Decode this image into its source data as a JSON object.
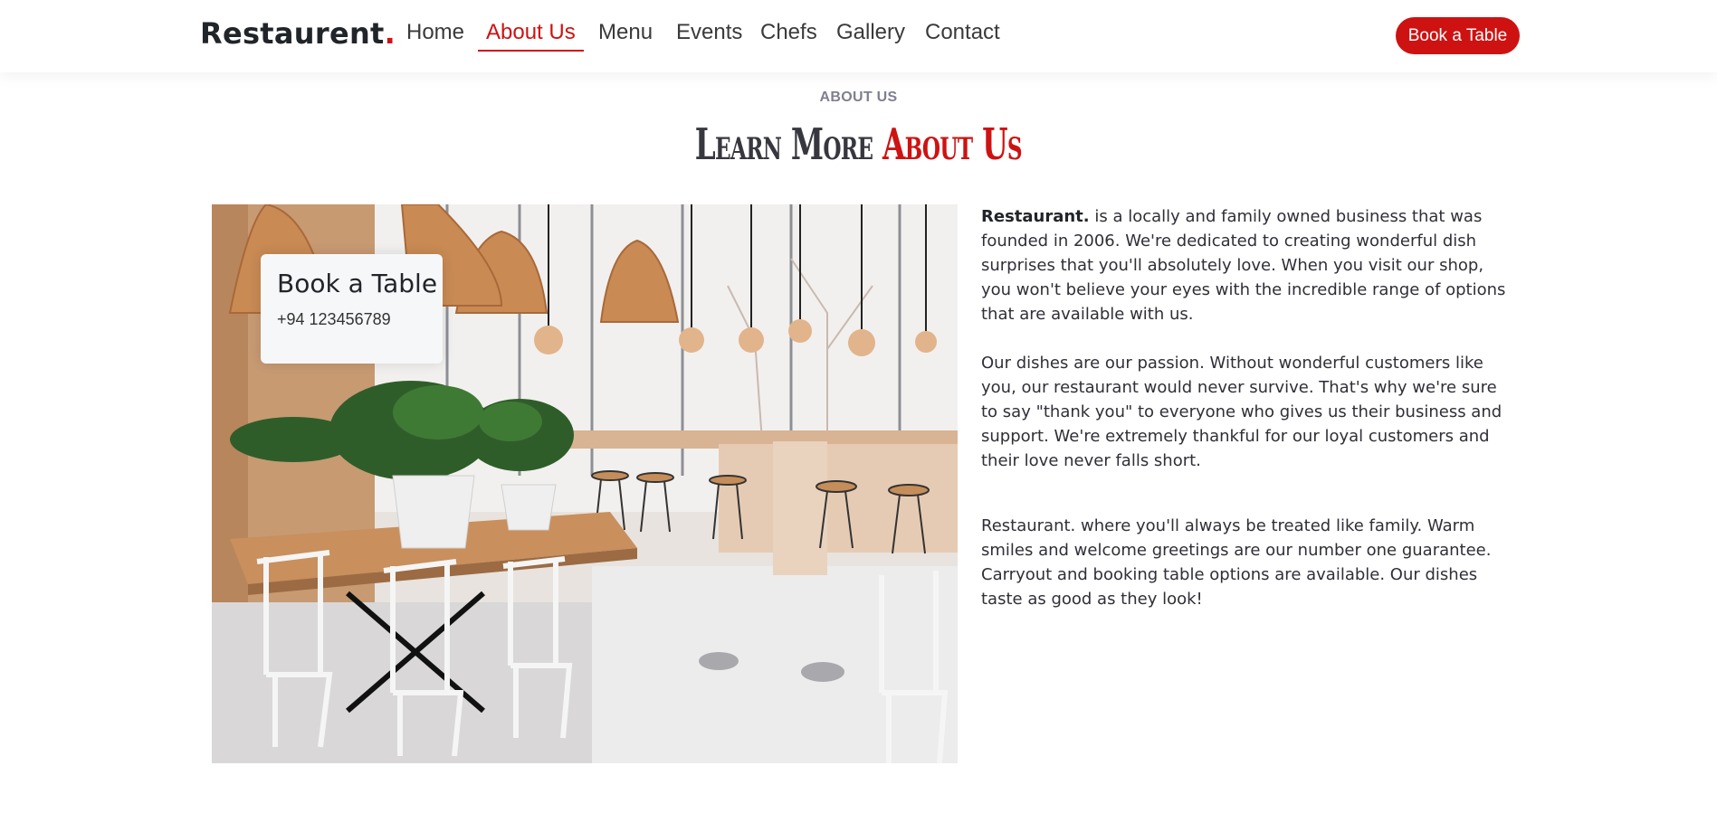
{
  "header": {
    "logo_text": "Restaurent",
    "logo_dot": ".",
    "nav": [
      {
        "label": "Home",
        "active": false
      },
      {
        "label": "About Us",
        "active": true
      },
      {
        "label": "Menu",
        "active": false
      },
      {
        "label": "Events",
        "active": false
      },
      {
        "label": "Chefs",
        "active": false
      },
      {
        "label": "Gallery",
        "active": false
      },
      {
        "label": "Contact",
        "active": false
      }
    ],
    "cta_label": "Book a Table"
  },
  "about": {
    "eyebrow": "ABOUT US",
    "title_main": "Learn More ",
    "title_accent": "About Us",
    "card": {
      "title": "Book a Table",
      "phone": "+94 123456789"
    },
    "para1_bold": "Restaurant.",
    "para1_rest": " is a locally and family owned business that was founded in 2006. We're dedicated to creating wonderful dish surprises that you'll absolutely love. When you visit our shop, you won't believe your eyes with the incredible range of options that are available with us.",
    "para2": "Our dishes are our passion. Without wonderful customers like you, our restaurant would never survive. That's why we're sure to say \"thank you\" to everyone who gives us their business and support. We're extremely thankful for our loyal customers and their love never falls short.",
    "para3": "Restaurant. where you'll always be treated like family. Warm smiles and welcome greetings are our number one guarantee. Carryout and booking table options are available. Our dishes taste as good as they look!"
  },
  "colors": {
    "accent": "#ce1212",
    "text": "#212529",
    "muted": "#7f7f90"
  },
  "image": {
    "subject": "restaurant-interior-photo"
  }
}
